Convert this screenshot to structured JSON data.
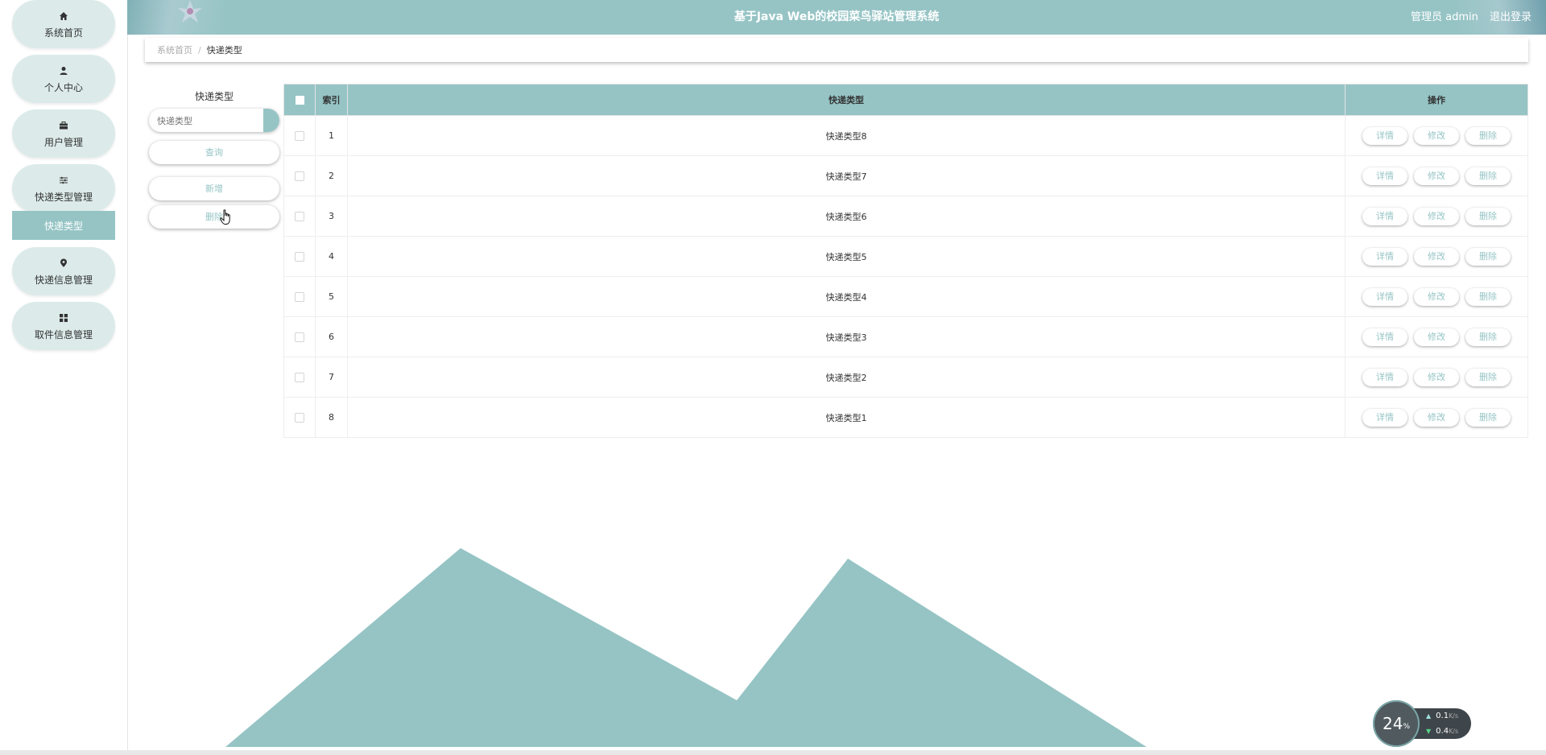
{
  "app": {
    "title": "基于Java Web的校园菜鸟驿站管理系统",
    "user_role": "管理员 admin",
    "logout_label": "退出登录"
  },
  "sidebar": {
    "items": [
      {
        "label": "系统首页",
        "icon": "home-icon"
      },
      {
        "label": "个人中心",
        "icon": "user-icon"
      },
      {
        "label": "用户管理",
        "icon": "briefcase-icon"
      },
      {
        "label": "快递类型管理",
        "icon": "sliders-icon"
      },
      {
        "label": "快递信息管理",
        "icon": "map-pin-icon"
      },
      {
        "label": "取件信息管理",
        "icon": "grid-icon"
      }
    ],
    "active_sub": "快递类型"
  },
  "breadcrumb": {
    "home": "系统首页",
    "current": "快递类型"
  },
  "search": {
    "label": "快递类型",
    "placeholder": "快递类型",
    "query_label": "查询",
    "add_label": "新增",
    "delete_label": "删除"
  },
  "table": {
    "headers": {
      "index": "索引",
      "type": "快递类型",
      "ops": "操作"
    },
    "rows": [
      {
        "index": "1",
        "type": "快递类型8"
      },
      {
        "index": "2",
        "type": "快递类型7"
      },
      {
        "index": "3",
        "type": "快递类型6"
      },
      {
        "index": "4",
        "type": "快递类型5"
      },
      {
        "index": "5",
        "type": "快递类型4"
      },
      {
        "index": "6",
        "type": "快递类型3"
      },
      {
        "index": "7",
        "type": "快递类型2"
      },
      {
        "index": "8",
        "type": "快递类型1"
      }
    ],
    "ops": {
      "detail": "详情",
      "edit": "修改",
      "delete": "删除"
    }
  },
  "speed_widget": {
    "percent": "24",
    "percent_unit": "%",
    "upload": "0.1",
    "download": "0.4",
    "unit": "K/s"
  },
  "colors": {
    "accent": "#96c4c5",
    "nav_bg": "#dcebea"
  }
}
